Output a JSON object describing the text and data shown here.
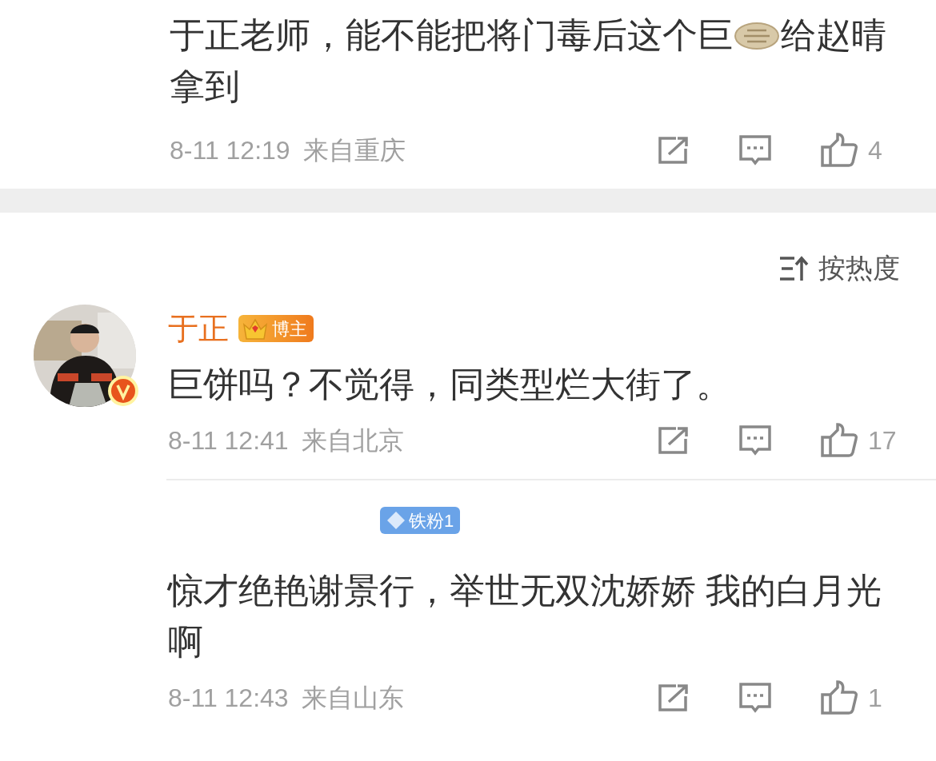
{
  "top_comment": {
    "text_parts": [
      {
        "kind": "text",
        "text": "于正老师，能不能把将门毒后这个巨"
      },
      {
        "kind": "emoji"
      },
      {
        "kind": "text",
        "text": "给赵晴拿到"
      }
    ],
    "date": "8-11 12:19",
    "location": "来自重庆",
    "likes": "4"
  },
  "sort": {
    "label": "按热度"
  },
  "comments": [
    {
      "verified": true,
      "name": "于正",
      "badge": {
        "kind": "blogger",
        "label": "博主"
      },
      "text": "巨饼吗？不觉得，同类型烂大街了。",
      "date": "8-11 12:41",
      "location": "来自北京",
      "likes": "17"
    },
    {
      "badge": {
        "kind": "fan",
        "label": "铁粉1"
      },
      "text": "惊才绝艳谢景行，举世无双沈娇娇 我的白月光啊",
      "date": "8-11 12:43",
      "location": "来自山东",
      "likes": "1"
    }
  ]
}
